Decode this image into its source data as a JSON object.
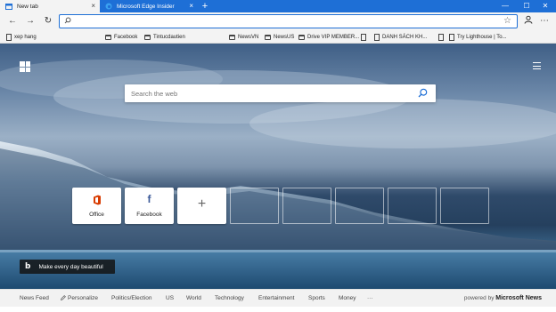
{
  "tabs": [
    {
      "label": "New tab",
      "close": "×",
      "active": true
    },
    {
      "label": "Microsoft Edge Insider",
      "close": "×",
      "active": false
    }
  ],
  "new_tab_symbol": "+",
  "window_controls": {
    "minimize": "—",
    "maximize": "☐",
    "close": "✕"
  },
  "toolbar": {
    "back": "←",
    "forward": "→",
    "refresh": "↻",
    "address_value": "",
    "favorite_star": "☆",
    "profile_icon": "profile-icon",
    "menu_dots": "⋯"
  },
  "favorites": [
    {
      "label": "xep hang",
      "icon": "page-icon"
    },
    {
      "label": "Facebook",
      "icon": "folder-icon"
    },
    {
      "label": "Tintucdautien",
      "icon": "folder-icon"
    },
    {
      "label": "NewsVN",
      "icon": "folder-icon"
    },
    {
      "label": "NewsUS",
      "icon": "folder-icon"
    },
    {
      "label": "Drive VIP MEMBER...",
      "icon": "folder-icon"
    },
    {
      "label": "",
      "icon": "page-icon"
    },
    {
      "label": "DANH SÁCH KH...",
      "icon": "page-icon"
    },
    {
      "label": "",
      "icon": "page-icon"
    },
    {
      "label": "Try Lighthouse | To...",
      "icon": "page-icon"
    }
  ],
  "search": {
    "placeholder": "Search the web"
  },
  "top_sites": [
    {
      "label": "Office",
      "icon": "office-icon"
    },
    {
      "label": "Facebook",
      "icon": "facebook-icon"
    }
  ],
  "add_site": "+",
  "bing": {
    "icon": "b",
    "text": "Make every day beautiful"
  },
  "news": {
    "items": [
      "News Feed",
      "Personalize",
      "Politics/Election",
      "US",
      "World",
      "Technology",
      "Entertainment",
      "Sports",
      "Money",
      "···"
    ],
    "powered_prefix": "powered by",
    "powered_brand": "Microsoft News"
  },
  "colors": {
    "accent": "#1e6fd6",
    "office": "#d83b01",
    "facebook": "#3b5998"
  }
}
